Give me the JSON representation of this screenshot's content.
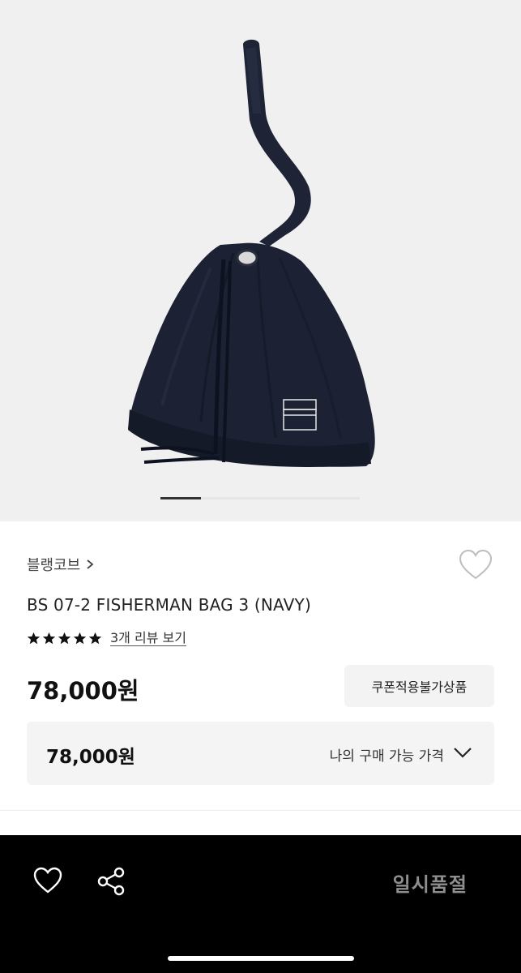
{
  "brand": {
    "name": "블랭코브"
  },
  "product": {
    "title": "BS 07-2 FISHERMAN BAG 3 (NAVY)",
    "rating": 5,
    "review_link": "3개 리뷰 보기",
    "price": "78,000원"
  },
  "coupon": {
    "label": "쿠폰적용불가상품"
  },
  "my_price": {
    "price": "78,000원",
    "label": "나의 구매 가능 가격"
  },
  "gallery": {
    "current_index": 1,
    "total": 5
  },
  "bottom_bar": {
    "status_label": "일시품절"
  },
  "icons": {
    "wishlist": "heart-outline-icon",
    "share": "share-icon",
    "expand": "chevron-down-icon",
    "brand_link": "chevron-right-icon",
    "rating": "star-icon"
  },
  "colors": {
    "background": "#ffffff",
    "hero_bg": "#f0f0f0",
    "bag": "#1c2233",
    "bottom_bar": "#000000",
    "soldout_text": "#8e8e8e"
  }
}
